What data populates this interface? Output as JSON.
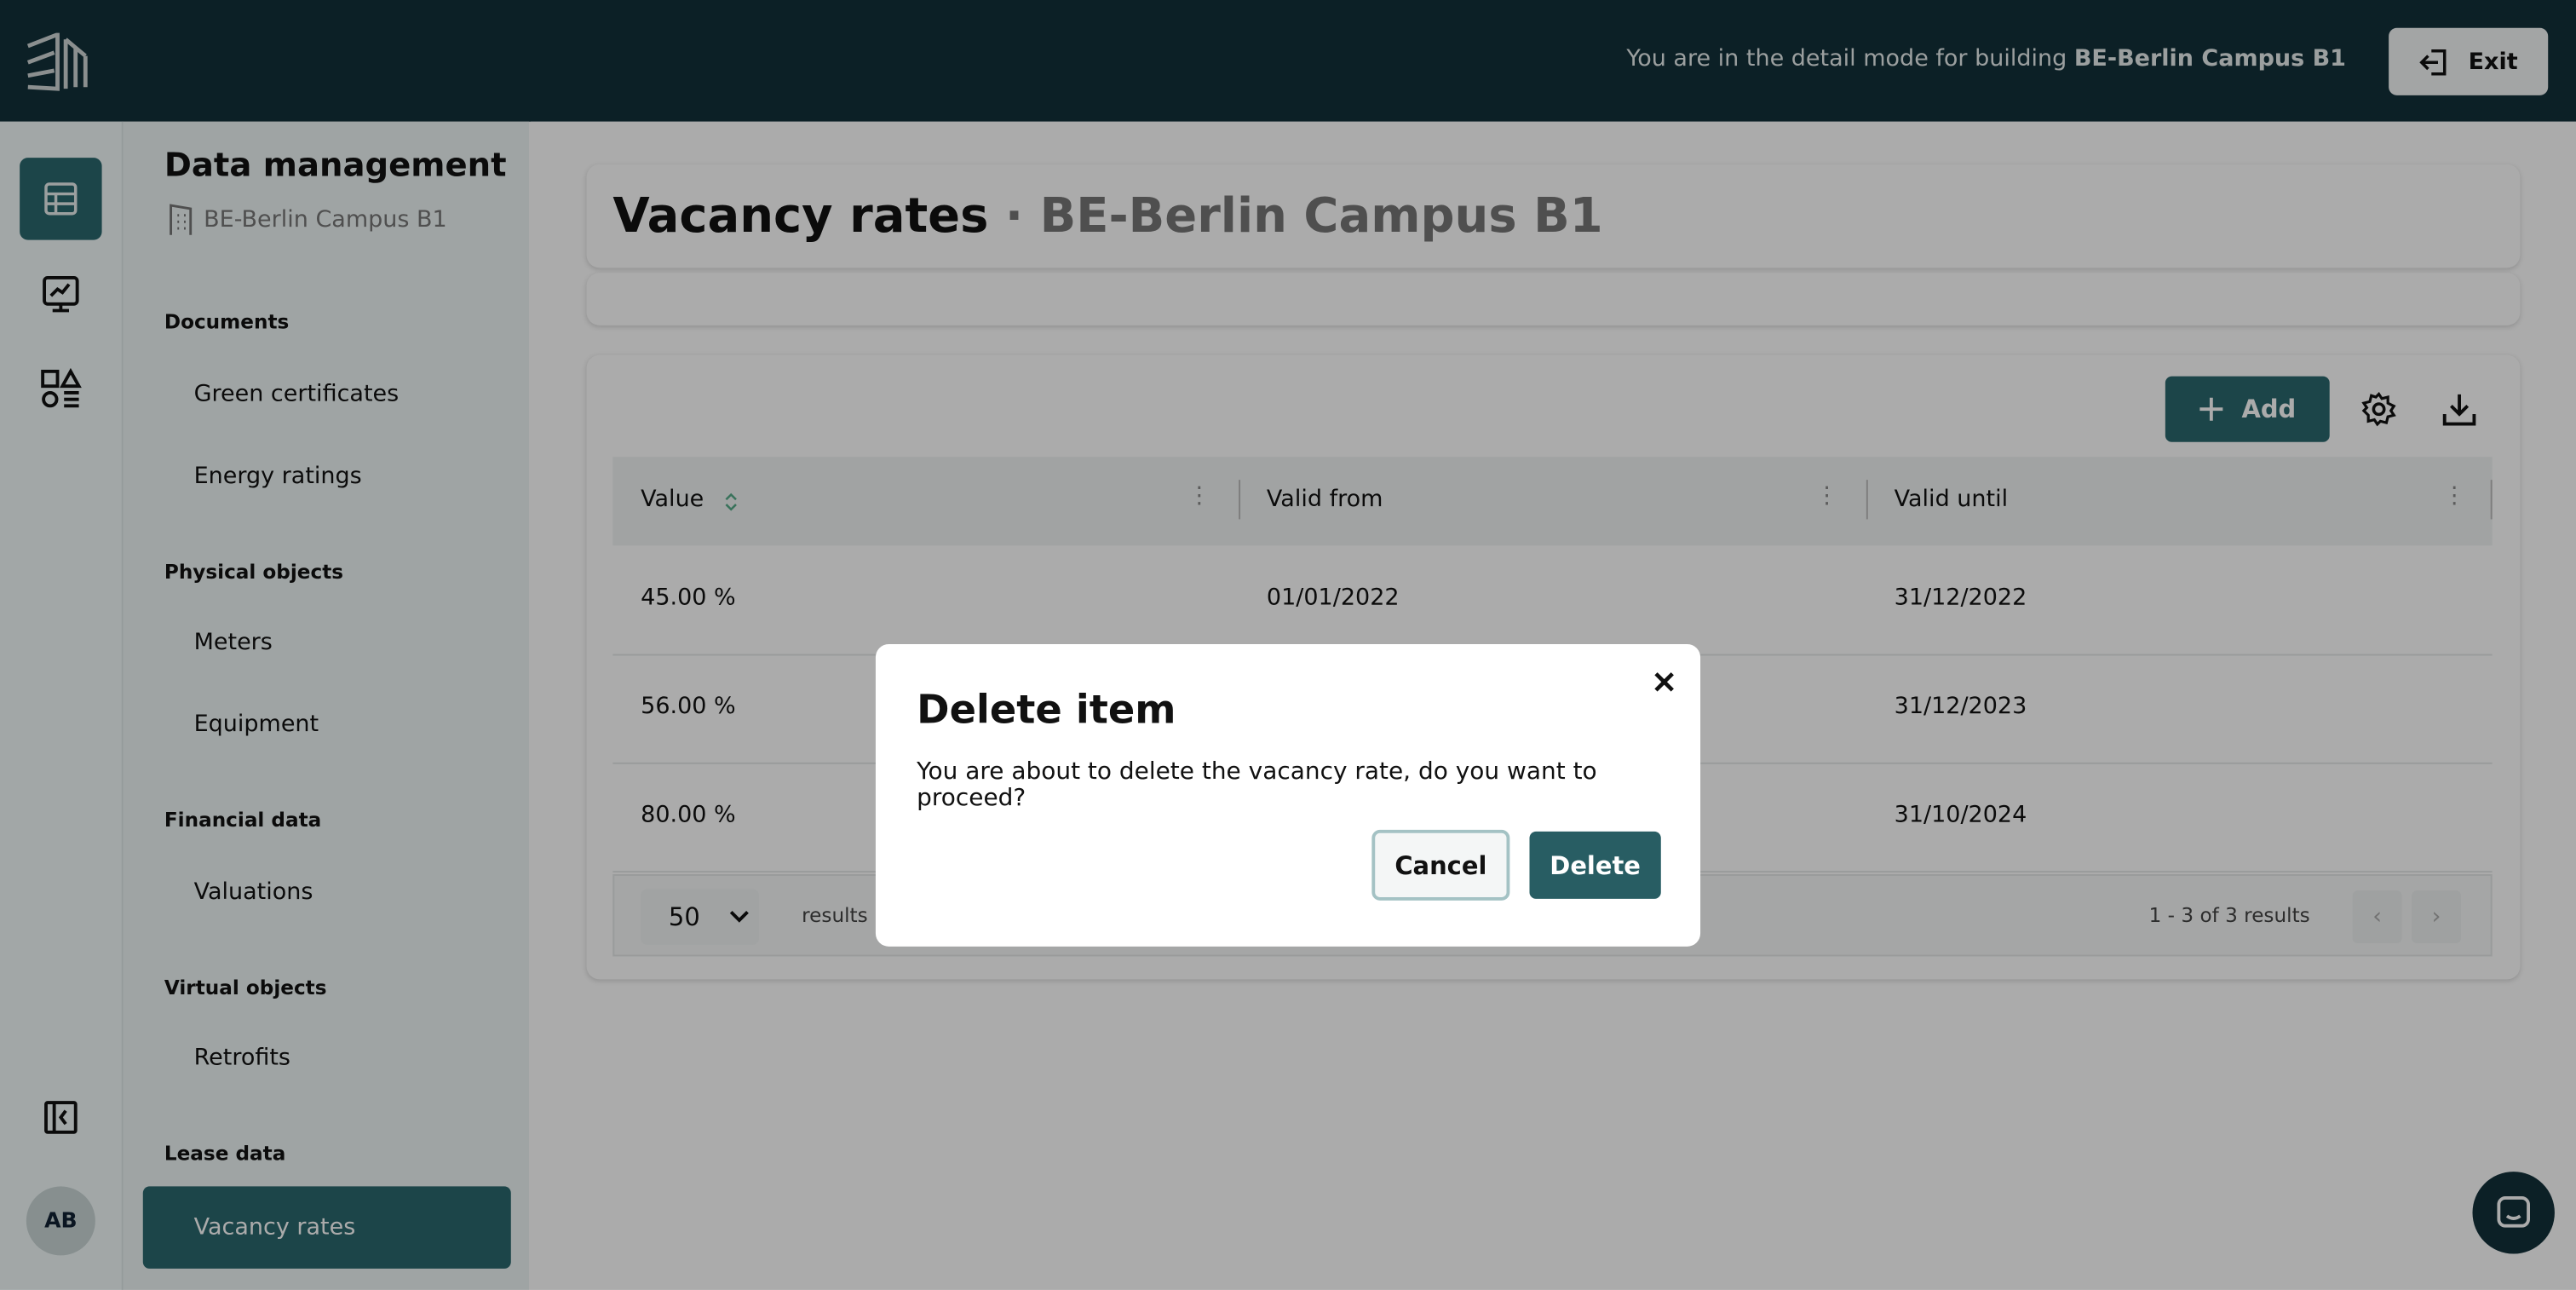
{
  "header": {
    "mode_text": "You are in the detail mode for building ",
    "building": "BE-Berlin Campus B1",
    "exit_label": "Exit"
  },
  "rail": {
    "avatar_initials": "AB"
  },
  "sidebar": {
    "title": "Data management",
    "building": "BE-Berlin Campus B1",
    "sections": [
      {
        "label": "Documents",
        "items": [
          "Green certificates",
          "Energy ratings"
        ]
      },
      {
        "label": "Physical objects",
        "items": [
          "Meters",
          "Equipment"
        ]
      },
      {
        "label": "Financial data",
        "items": [
          "Valuations"
        ]
      },
      {
        "label": "Virtual objects",
        "items": [
          "Retrofits"
        ]
      },
      {
        "label": "Lease data",
        "items": [
          "Vacancy rates"
        ]
      }
    ],
    "active_item": "Vacancy rates"
  },
  "page": {
    "title": "Vacancy rates",
    "separator": " · ",
    "subtitle": "BE-Berlin Campus B1",
    "add_label": "Add"
  },
  "table": {
    "columns": [
      "Value",
      "Valid from",
      "Valid until"
    ],
    "rows": [
      [
        "45.00 %",
        "01/01/2022",
        "31/12/2022"
      ],
      [
        "56.00 %",
        "",
        "31/12/2023"
      ],
      [
        "80.00 %",
        "",
        "31/10/2024"
      ]
    ],
    "page_size": "50",
    "page_size_label": "results p",
    "range_text": "1 - 3 of 3 results"
  },
  "modal": {
    "title": "Delete item",
    "message": "You are about to delete the vacancy rate, do you want to proceed?",
    "cancel_label": "Cancel",
    "delete_label": "Delete"
  },
  "colors": {
    "header": "#12303a",
    "accent": "#2b676d"
  }
}
